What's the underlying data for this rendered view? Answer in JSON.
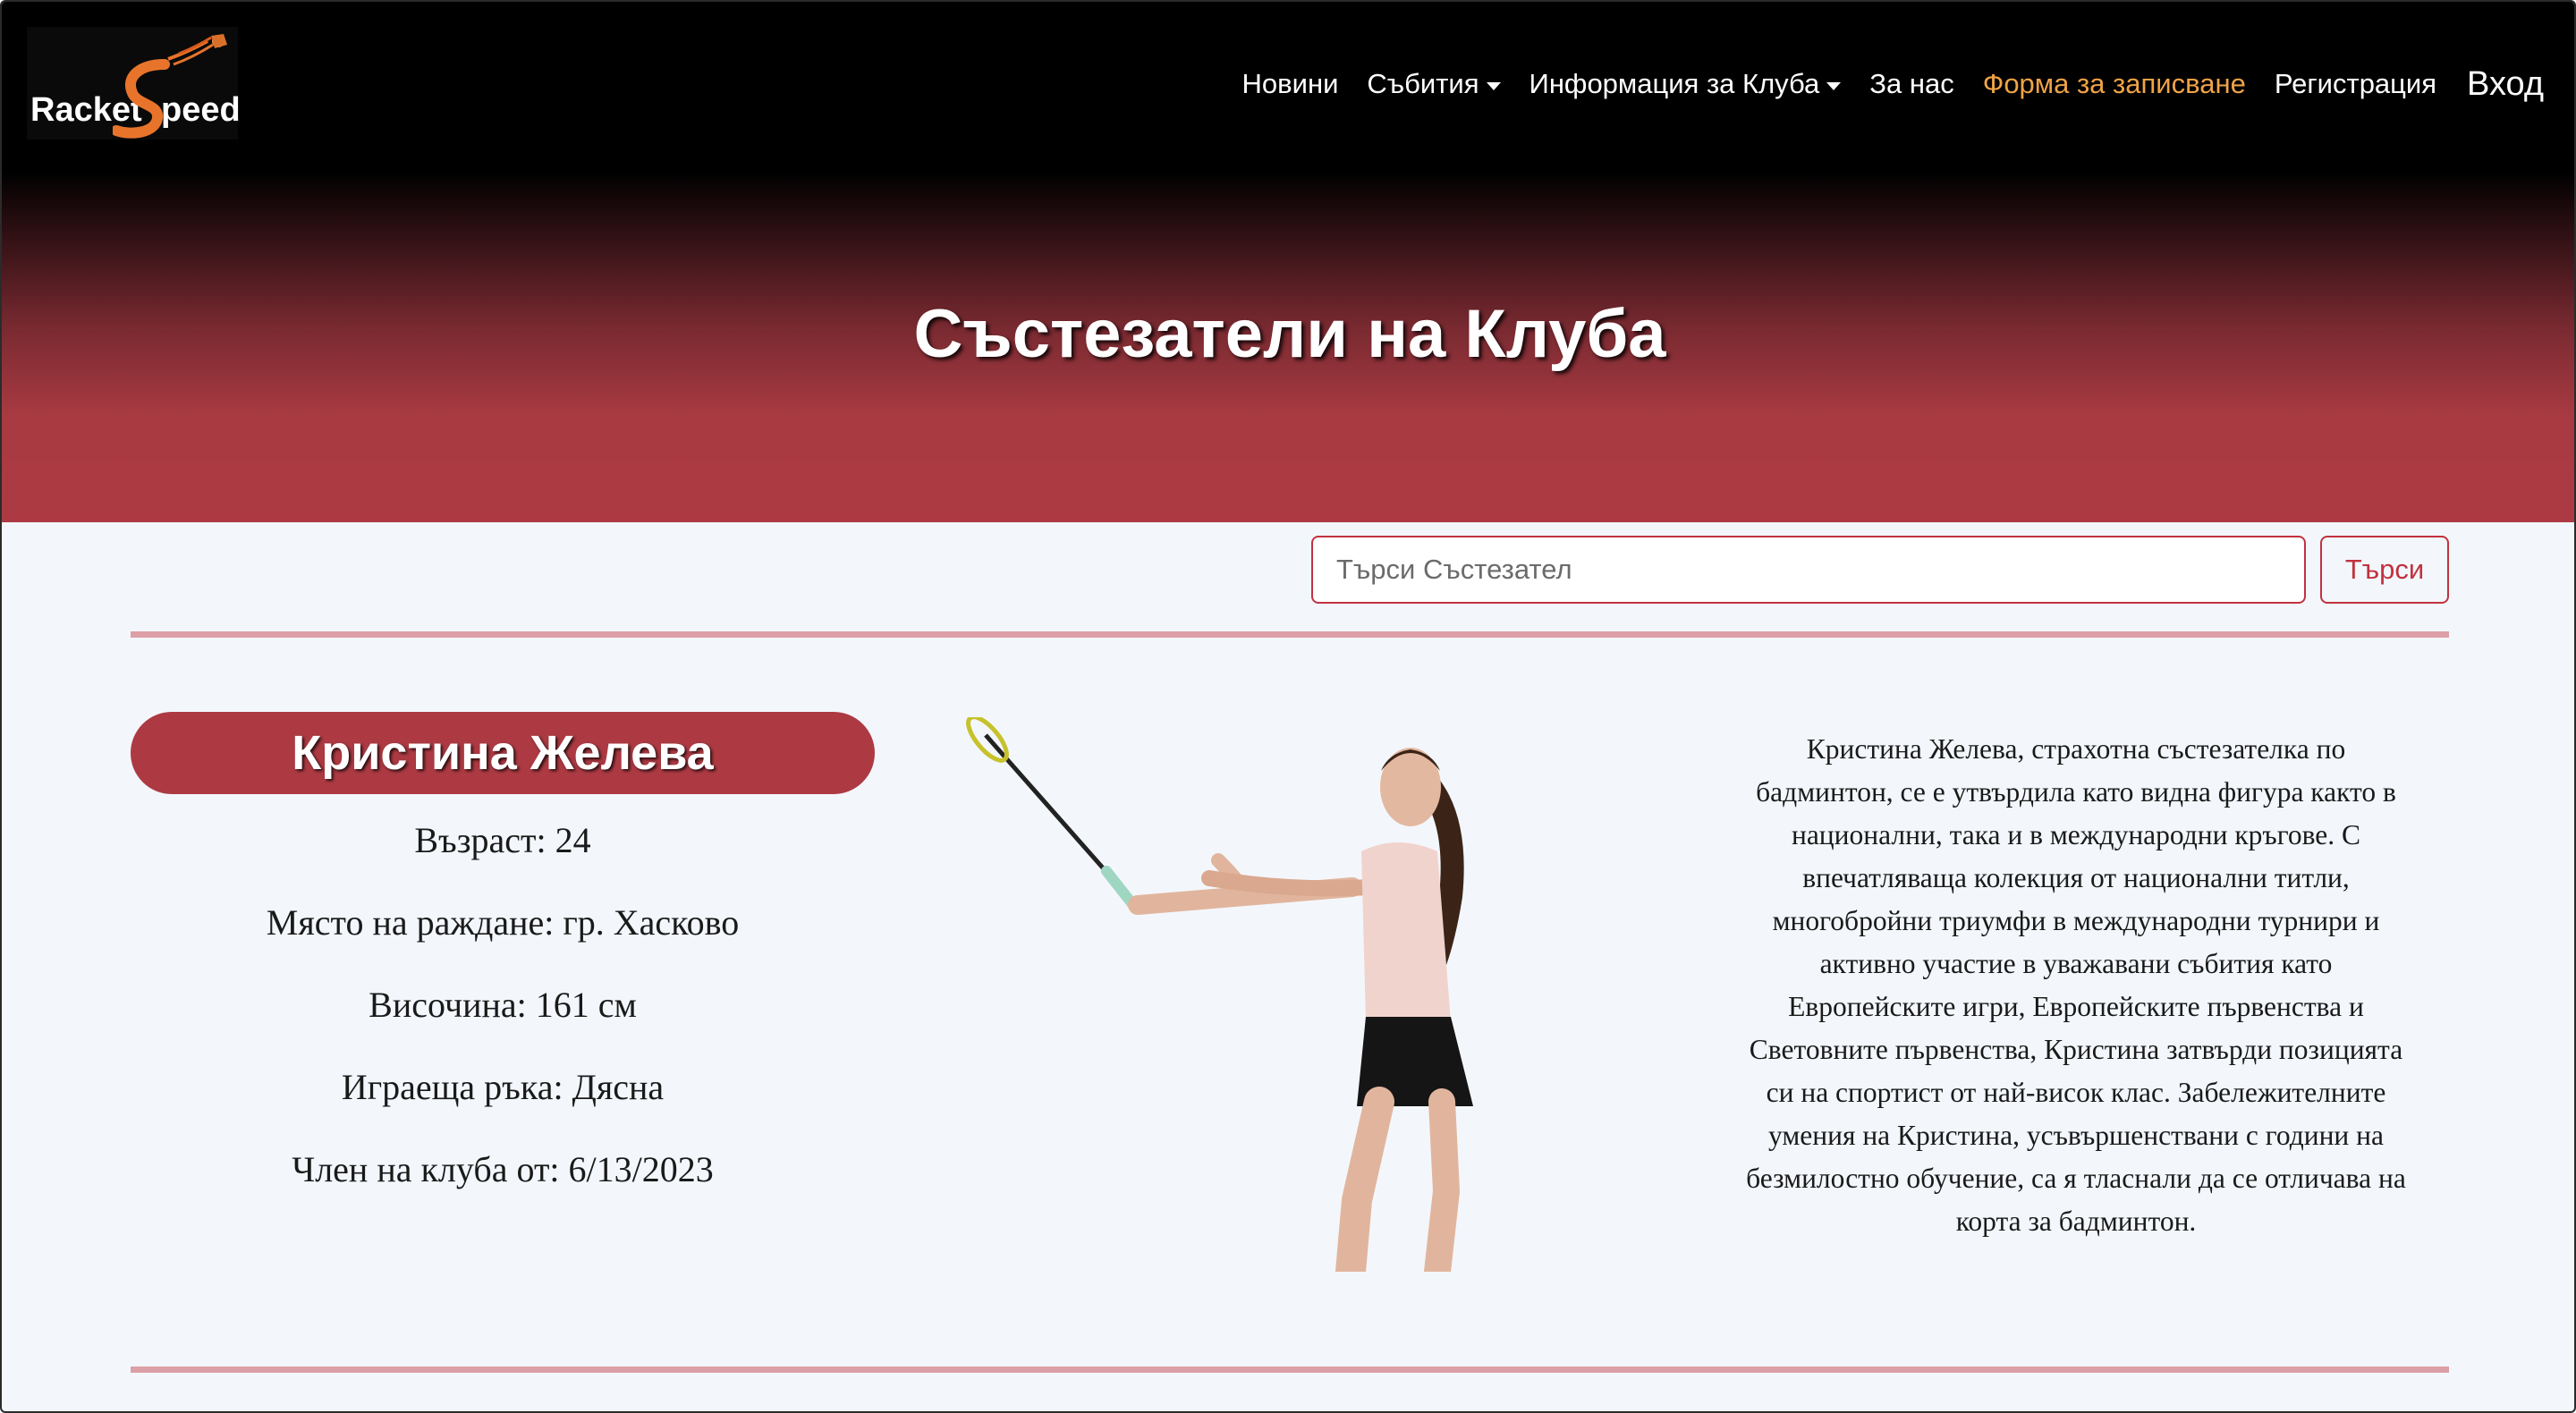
{
  "brand": {
    "logo_racket": "Racket",
    "logo_speed": "peed"
  },
  "nav": {
    "items": [
      {
        "label": "Новини",
        "dropdown": false
      },
      {
        "label": "Събития",
        "dropdown": true
      },
      {
        "label": "Информация за Клуба",
        "dropdown": true
      },
      {
        "label": "За нас",
        "dropdown": false
      },
      {
        "label": "Форма за записване",
        "dropdown": false,
        "active": true
      },
      {
        "label": "Регистрация",
        "dropdown": false
      }
    ],
    "login_label": "Вход",
    "active_color": "#f0a346"
  },
  "hero": {
    "title": "Състезатели на Клуба"
  },
  "search": {
    "placeholder": "Търси Състезател",
    "value": "",
    "button_label": "Търси"
  },
  "athlete": {
    "name": "Кристина Желева",
    "facts": [
      "Възраст: 24",
      "Място на раждане: гр. Хасково",
      "Височина: 161 см",
      "Играеща ръка: Дясна",
      "Член на клуба от: 6/13/2023"
    ],
    "bio": "Кристина Желева, страхотна състезателка по бадминтон, се е утвърдила като видна фигура както в национални, така и в международни кръгове. С впечатляваща колекция от национални титли, многобройни триумфи в международни турнири и активно участие в уважавани събития като Европейските игри, Европейските първенства и Световните първенства, Кристина затвърди позицията си на спортист от най-висок клас. Забележителните умения на Кристина, усъвършенствани с години на безмилостно обучение, са я тласнали да се отличава на корта за бадминтон."
  },
  "colors": {
    "accent": "#ad3a43",
    "button": "#c1323e",
    "divider": "#dc9fa5",
    "background": "#f3f7fc"
  }
}
